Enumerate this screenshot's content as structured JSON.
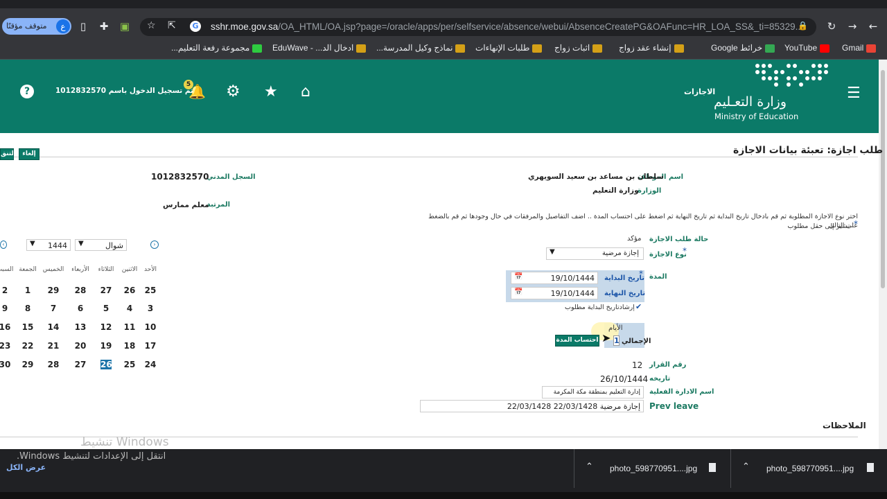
{
  "browser": {
    "profile_status": "متوقف مؤقتًا",
    "profile_initial": "ع",
    "url_host": "sshr.moe.gov.sa",
    "url_path": "/OA_HTML/OA.jsp?page=/oracle/apps/per/selfservice/absence/webui/AbsenceCreatePG&OAFunc=HR_LOA_SS&_ti=85329...",
    "bookmarks": [
      {
        "label": "Gmail",
        "color": "#ea4335"
      },
      {
        "label": "YouTube",
        "color": "#ff0000"
      },
      {
        "label": "خرائط Google",
        "color": "#34a853"
      },
      {
        "label": "إنشاء عقد زواج",
        "color": "#d4a017"
      },
      {
        "label": "اثبات زواج",
        "color": "#d4a017"
      },
      {
        "label": "طلبات الإنهاءات",
        "color": "#d4a017"
      },
      {
        "label": "نماذج وكيل المدرسة...",
        "color": "#d4a017"
      },
      {
        "label": "ادخال الد... - EduWave",
        "color": "#d4a017"
      },
      {
        "label": "مجموعة رفعة التعليم...",
        "color": "#2ecc40"
      }
    ]
  },
  "header": {
    "ministry_ar": "وزارة التعـليم",
    "ministry_en": "Ministry of Education",
    "section_title": "الاجازات",
    "logged_in": "تم تسجيل الدخول باسم 1012832570",
    "notification_count": "5"
  },
  "page": {
    "title": "طلب اجازة: تعبئة بيانات الاجازة",
    "cancel_button": "إلغاء",
    "next_button": "التنق",
    "employee_name_label": "اسم الموظف",
    "employee_name": "سلطان بن مساعد بن سعيد السويهري",
    "civil_id_label": "السجل المدني",
    "civil_id": "1012832570",
    "ministry_label": "الوزارة",
    "ministry": "وزارة التعليم",
    "rank_label": "المرتبة",
    "rank": "معلم ممارس",
    "instructions": "اختر نوع الاجازة المطلوبة ثم قم بادخال تاريخ البداية ثم تاريخ النهاية ثم اضغط على احتساب المدة .. اضف التفاصيل والمرفقات في حال وجودها ثم قم بالضغط على التالي",
    "required_note": "تشير إلى حقل مطلوب",
    "status_label": "حالة طلب الاجازة",
    "status_value": "مؤكد",
    "leave_type_label": "نوع الاجازة",
    "leave_type_value": "إجازة مرضية",
    "duration_label": "المدة",
    "start_date_label": "تاريخ البداية",
    "start_date": "19/10/1444",
    "end_date_label": "تاريخ النهاية",
    "end_date": "19/10/1444",
    "start_required_hint": "إرشادتاريخ البداية مطلوب",
    "days_label": "الأيام",
    "total_label": "الإجمالي",
    "total_value": "1",
    "calc_button": "احتساب المدة",
    "decision_no_label": "رقم القرار",
    "decision_no": "12",
    "decision_date_label": "تاريخه",
    "decision_date": "26/10/1444",
    "admin_label": "اسم الادارة الفعلية",
    "admin_value": "إدارة التعليم بمنطقة مكة المكرمة",
    "prev_leave_label": "Prev leave",
    "prev_leave_value": "إجازة مرضية 22/03/1428 22/03/1428",
    "notes_label": "الملاحظات"
  },
  "calendar": {
    "month": "شوال",
    "year": "1444",
    "weekdays": [
      "الأحد",
      "الاثنين",
      "الثلاثاء",
      "الأربعاء",
      "الخميس",
      "الجمعة",
      "السبت"
    ],
    "weeks": [
      [
        "25",
        "26",
        "27",
        "28",
        "29",
        "1",
        "2"
      ],
      [
        "3",
        "4",
        "5",
        "6",
        "7",
        "8",
        "9"
      ],
      [
        "10",
        "11",
        "12",
        "13",
        "14",
        "15",
        "16"
      ],
      [
        "17",
        "18",
        "19",
        "20",
        "21",
        "22",
        "23"
      ],
      [
        "24",
        "25",
        "26",
        "27",
        "28",
        "29",
        "30"
      ]
    ],
    "today": "26"
  },
  "windows": {
    "activate_title": "تنشيط Windows",
    "activate_msg": "انتقل إلى الإعدادات لتنشيط Windows."
  },
  "downloads": {
    "show_all": "عرض الكل",
    "files": [
      "photo_598770951....jpg",
      "photo_598770951....jpg"
    ]
  }
}
